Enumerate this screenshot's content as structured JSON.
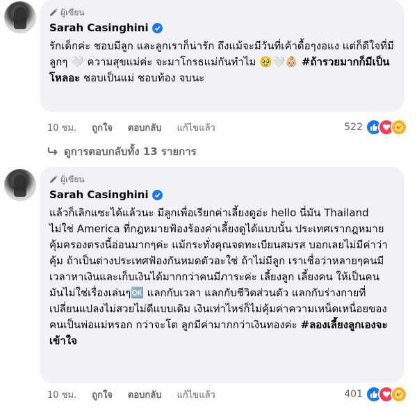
{
  "comments": [
    {
      "author_badge": "ผู้เขียน",
      "name": "Sarah Casinghini",
      "text": "รักเด็กค่ะ ชอบมีลูก และลูกเราก็น่ารัก ถึงแม้จะมีวันที่เค้าดื้อๆงอแง แต่ก็ดีใจที่มีลูกๆ 🤍 ความสุขแม่ค่ะ จะมาโกรธแม่กันทำไม 🥹🤍👶🏼",
      "hashtag": "#ถ้ารวยมากก็มีเป็นโหลอะ",
      "text_after": "ชอบเป็นแม่ ชอบท้อง จบนะ",
      "time": "10 ชม.",
      "like": "ถูกใจ",
      "reply": "ตอบกลับ",
      "edited": "แก้ไขแล้ว",
      "reaction_count": "522"
    },
    {
      "author_badge": "ผู้เขียน",
      "name": "Sarah Casinghini",
      "text": "แล้วก็เลิกแซะได้แล้วนะ มีลูกเพื่อเรียกค่าเลี้ยงดูอ่ะ hello นี่มัน Thailand ไม่ใช่ America ที่กฎหมายฟ้องร้องค่าเลี้ยงดูได้แบบนั้น ประเทศเรากฎหมายคุ้มครองตรงนี้อ่อนมากๆค่ะ แม้กระทั่งคุณจดทะเบียนสมรส บอกเลยไม่มีค่าว่าคุ้ม ถ้าเป็นต่างประเทศฟ้องกันหมดตัวอะใช่ ถ้าไม่มีลูก เราเชื่อว่าหลายๆคนมีเวลาหาเงินและเก็บเงินได้มากกว่าคนมีภาระค่ะ เลี้ยงลูก เลี้ยงคน ให้เป็นคน มันไม่ใช่เรื่องเล่นๆ🆗 แลกกับเวลา แลกกับชีวิตส่วนตัว แลกกับร่างกายที่เปลี่ยนแปลงไม่สวยไม่ดีแบบเดิม เงินเท่าไหร่ก็ไม่คุ้มค่าความเหน็ดเหนื่อยของคนเป็นพ่อแม่หรอก กว่าจะโต ลูกมีค่ามากกว่าเงินทองค่ะ",
      "hashtag": "#ลองเลี้ยงลูกเองจะเข้าใจ",
      "time": "10 ชม.",
      "like": "ถูกใจ",
      "reply": "ตอบกลับ",
      "edited": "แก้ไขแล้ว",
      "reaction_count": "401"
    }
  ],
  "view_replies": "ดูการตอบกลับทั้ง 13 รายการ",
  "colors": {
    "bubble": "#f0f2f5",
    "secondary_text": "#65676b",
    "verified": "#1877f2",
    "like": "#1877f2",
    "love": "#f33e58",
    "care": "#f7b125"
  },
  "icons": [
    "pen-icon",
    "verified-badge-icon",
    "reply-arrow-icon",
    "like-reaction-icon",
    "love-reaction-icon",
    "care-reaction-icon"
  ]
}
